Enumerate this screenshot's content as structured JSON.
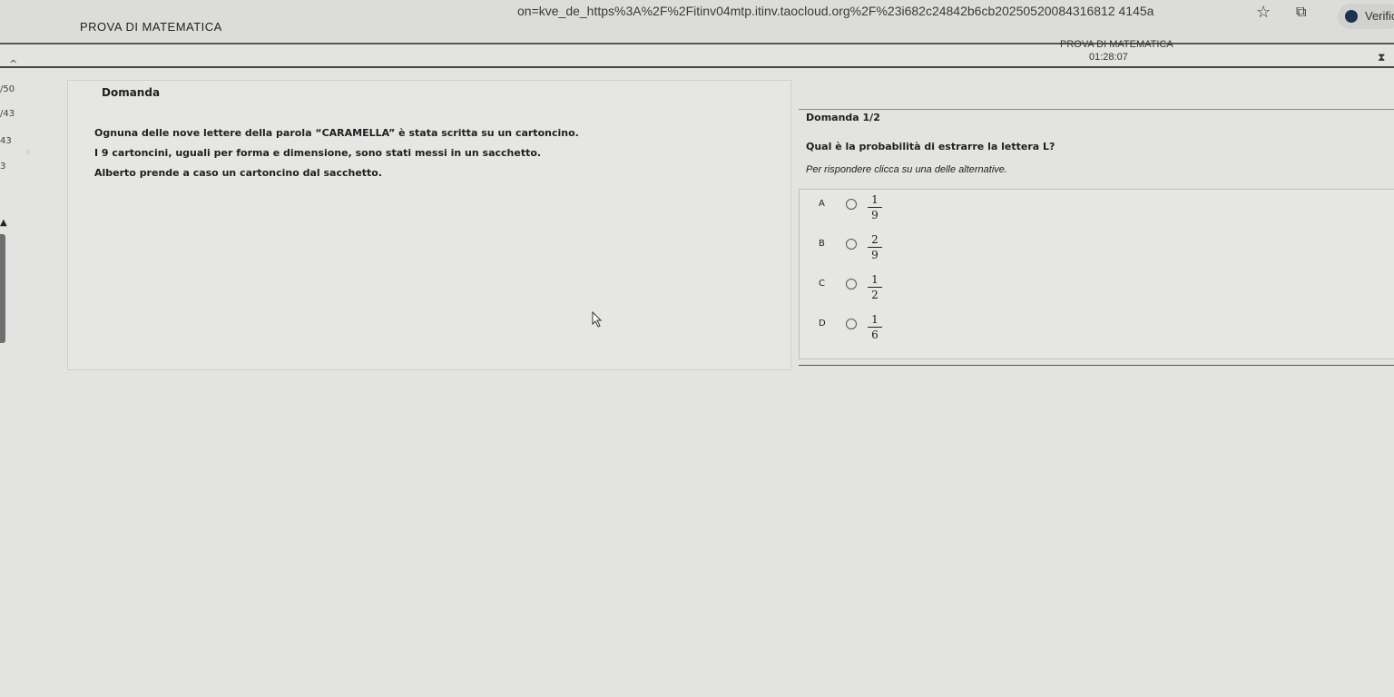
{
  "browser": {
    "url": "on=kve_de_https%3A%2F%2Fitinv04mtp.itinv.taocloud.org%2F%23i682c24842b6cb20250520084316812 4145a",
    "star_icon": "star-icon",
    "extension_icon": "extension-icon",
    "profile_label": "Verific"
  },
  "header": {
    "title": "PROVA DI MATEMATICA",
    "test_name": "PROVA DI MATEMATICA",
    "timer": "01:28:07"
  },
  "navigator": {
    "items": [
      "/50",
      "/43",
      "43",
      "3"
    ]
  },
  "stimulus": {
    "heading": "Domanda",
    "paragraphs": [
      "Ognuna delle nove lettere della parola “CARAMELLA” è stata scritta su un cartoncino.",
      "I 9 cartoncini, uguali per forma e dimensione, sono stati messi in un sacchetto.",
      "Alberto prende a caso un cartoncino dal sacchetto."
    ]
  },
  "question": {
    "label": "Domanda 1/2",
    "text": "Qual è la probabilità di estrarre la lettera L?",
    "instruction": "Per rispondere clicca su una delle alternative.",
    "choices": [
      {
        "letter": "A",
        "num": "1",
        "den": "9"
      },
      {
        "letter": "B",
        "num": "2",
        "den": "9"
      },
      {
        "letter": "C",
        "num": "1",
        "den": "2"
      },
      {
        "letter": "D",
        "num": "1",
        "den": "6"
      }
    ]
  }
}
